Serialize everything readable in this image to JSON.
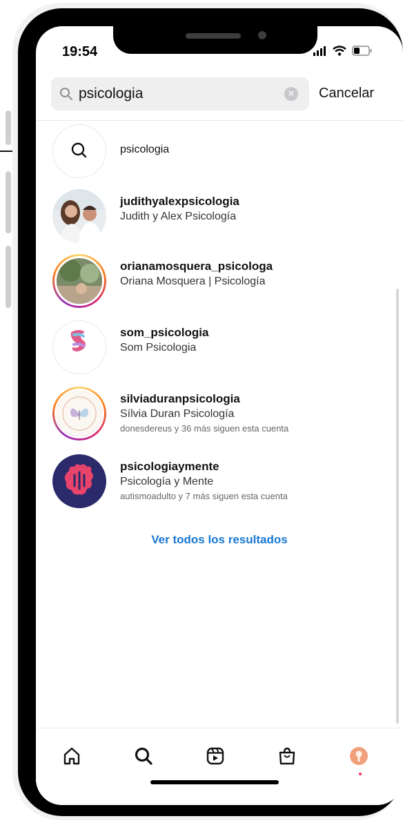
{
  "status_bar": {
    "time": "19:54"
  },
  "search": {
    "query": "psicologia",
    "cancel_label": "Cancelar"
  },
  "suggestion": {
    "label": "psicologia"
  },
  "results": [
    {
      "username": "judithyalexpsicologia",
      "full_name": "Judith y Alex Psicología",
      "followers_note": ""
    },
    {
      "username": "orianamosquera_psicologa",
      "full_name": "Oriana Mosquera | Psicología",
      "followers_note": ""
    },
    {
      "username": "som_psicologia",
      "full_name": "Som Psicologia",
      "followers_note": ""
    },
    {
      "username": "silviaduranpsicologia",
      "full_name": "Sílvia Duran Psicología",
      "followers_note": "donesdereus y 36 más siguen esta cuenta"
    },
    {
      "username": "psicologiaymente",
      "full_name": "Psicología y Mente",
      "followers_note": "autismoadulto y 7 más siguen esta cuenta"
    }
  ],
  "see_all_label": "Ver todos los resultados",
  "nav": {
    "items": [
      "home-icon",
      "search-icon",
      "reels-icon",
      "shop-icon",
      "profile-avatar"
    ]
  },
  "colors": {
    "link_blue": "#1877d2",
    "search_bg": "#efefef"
  }
}
